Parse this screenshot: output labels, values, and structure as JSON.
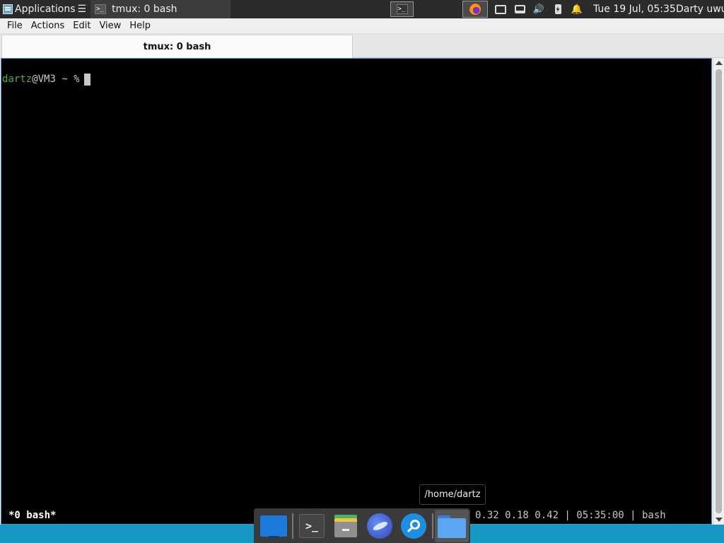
{
  "top_panel": {
    "applications_label": "Applications",
    "applications_suffix": "☰",
    "task_button_label": "tmux: 0 bash",
    "clock": "Tue 19 Jul, 05:35",
    "user": "Darty uwu"
  },
  "window": {
    "menu": [
      "File",
      "Actions",
      "Edit",
      "View",
      "Help"
    ],
    "tab_title": "tmux: 0 bash"
  },
  "terminal": {
    "prompt_user": "dartz",
    "prompt_rest": "@VM3 ~ %",
    "status_left": "*0 bash*",
    "status_right": "0.32 0.18 0.42 | 05:35:00 | bash"
  },
  "tooltip": "/home/dartz",
  "dock": {
    "items": [
      "desktop-icon",
      "terminal-icon",
      "file-manager-icon",
      "web-browser-icon",
      "search-icon",
      "home-folder-icon"
    ]
  }
}
